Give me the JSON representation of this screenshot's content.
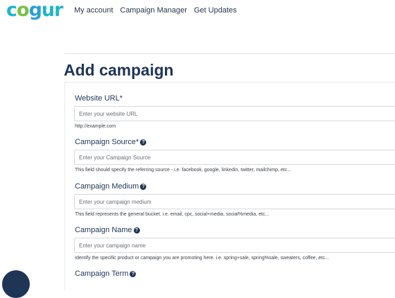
{
  "header": {
    "logo_text": [
      "c",
      "o",
      "g",
      "ur"
    ],
    "nav": [
      "My account",
      "Campaign Manager",
      "Get Updates"
    ]
  },
  "page_title": "Add campaign",
  "fields": [
    {
      "label": "Website URL*",
      "help": false,
      "placeholder": "Enter your website URL",
      "hint": "http://example.com"
    },
    {
      "label": "Campaign Source*",
      "help": true,
      "placeholder": "Enter your Campaign Source",
      "hint": "This field should specify the referring source - i.e. facebook, google, linkedin, twitter, mailchimp, etc..."
    },
    {
      "label": "Campaign Medium",
      "help": true,
      "placeholder": "Enter your campaign medium",
      "hint": "This field represents the general bucket. i.e. email, cpc, social+media, social%media, etc..."
    },
    {
      "label": "Campaign Name",
      "help": true,
      "placeholder": "Enter your campaign name",
      "hint": "Identify the specific product or campaign you are promoting here. i.e. spring+sale, spring%sale, sweaters, coffee, etc..."
    },
    {
      "label": "Campaign Term",
      "help": true
    }
  ],
  "help_icon_glyph": "?",
  "colors": {
    "brand_navy": "#1f3556",
    "logo_teal": "#1fb5c9",
    "logo_green": "#7ac143"
  }
}
